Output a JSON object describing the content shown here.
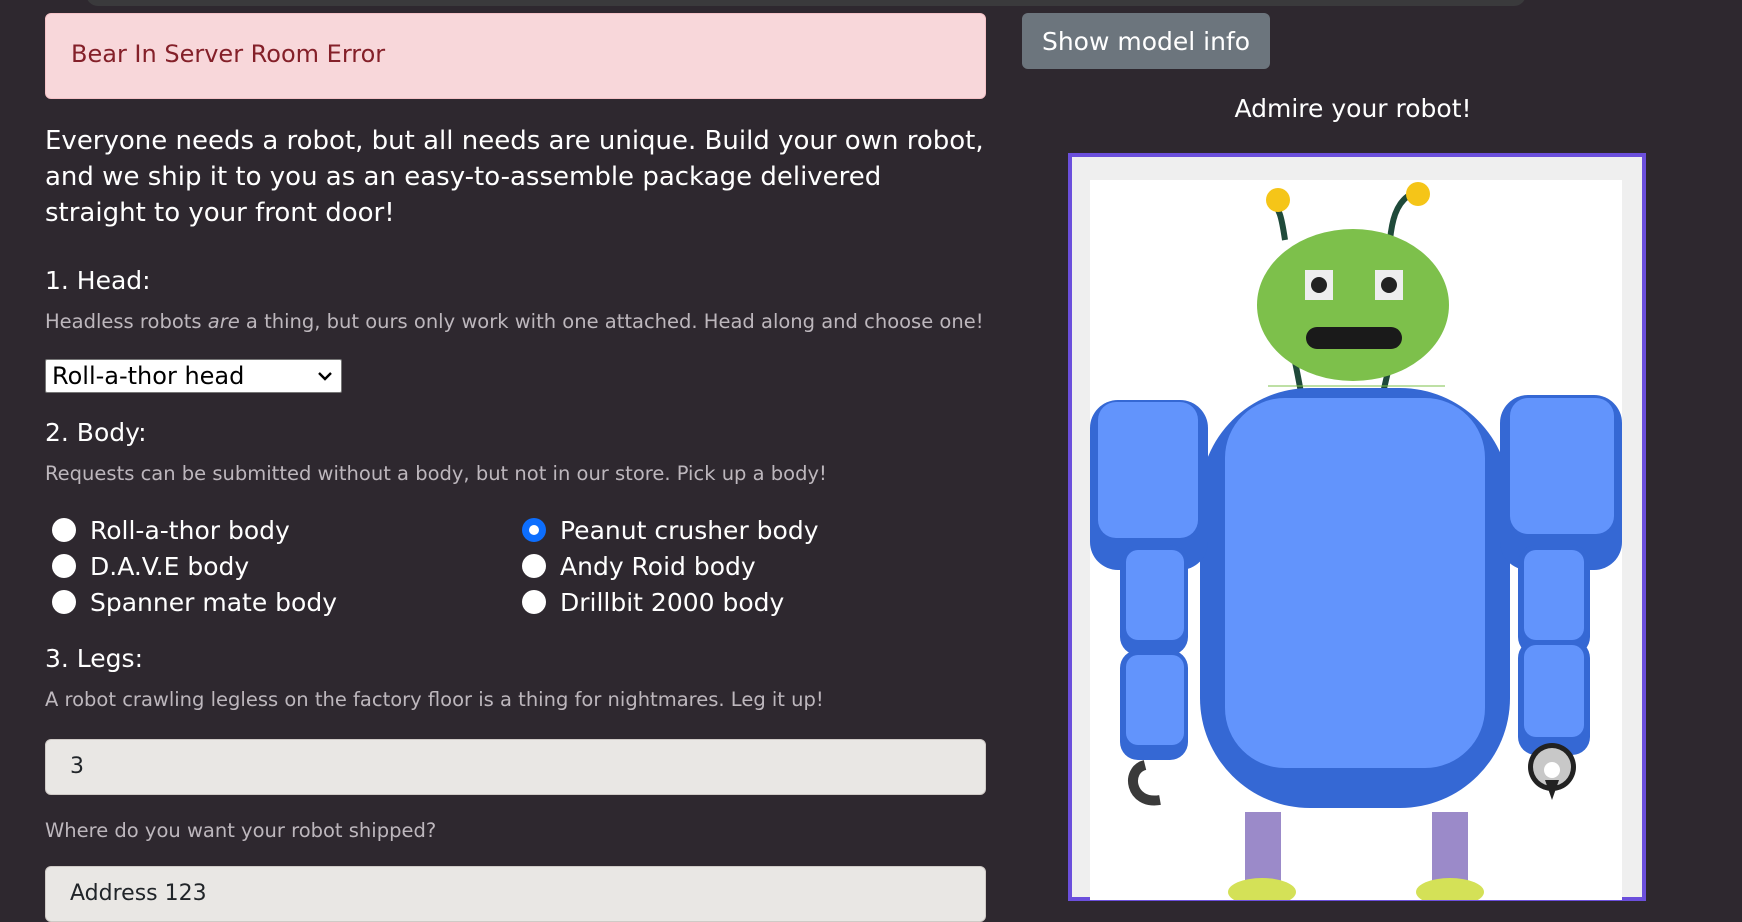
{
  "alert": {
    "text": "Bear In Server Room Error"
  },
  "intro": "Everyone needs a robot, but all needs are unique. Build your own robot, and we ship it to you as an easy-to-assemble package delivered straight to your front door!",
  "head": {
    "title": "1. Head:",
    "help_prefix": "Headless robots ",
    "help_em": "are",
    "help_suffix": " a thing, but ours only work with one attached. Head along and choose one!",
    "selected": "Roll-a-thor head"
  },
  "body": {
    "title": "2. Body:",
    "help": "Requests can be submitted without a body, but not in our store. Pick up a body!",
    "options": [
      {
        "label": "Roll-a-thor body",
        "checked": false
      },
      {
        "label": "Peanut crusher body",
        "checked": true
      },
      {
        "label": "D.A.V.E body",
        "checked": false
      },
      {
        "label": "Andy Roid body",
        "checked": false
      },
      {
        "label": "Spanner mate body",
        "checked": false
      },
      {
        "label": "Drillbit 2000 body",
        "checked": false
      }
    ]
  },
  "legs": {
    "title": "3. Legs:",
    "help": "A robot crawling legless on the factory floor is a thing for nightmares. Leg it up!",
    "value": "3"
  },
  "shipping": {
    "label": "Where do you want your robot shipped?",
    "placeholder": "Address 123"
  },
  "preview": {
    "model_info_button": "Show model info",
    "heading": "Admire your robot!"
  },
  "colors": {
    "background": "#2e282f",
    "alert_bg": "#f8d7da",
    "alert_text": "#842029",
    "button_secondary": "#6c757d",
    "frame_border": "#6b4fdc",
    "robot_head": "#7dc04b",
    "robot_body": "#3568d4",
    "robot_body_light": "#6294fc",
    "antenna_tip": "#f5c518",
    "legs": "#9b8ac9",
    "feet": "#d4e157"
  }
}
